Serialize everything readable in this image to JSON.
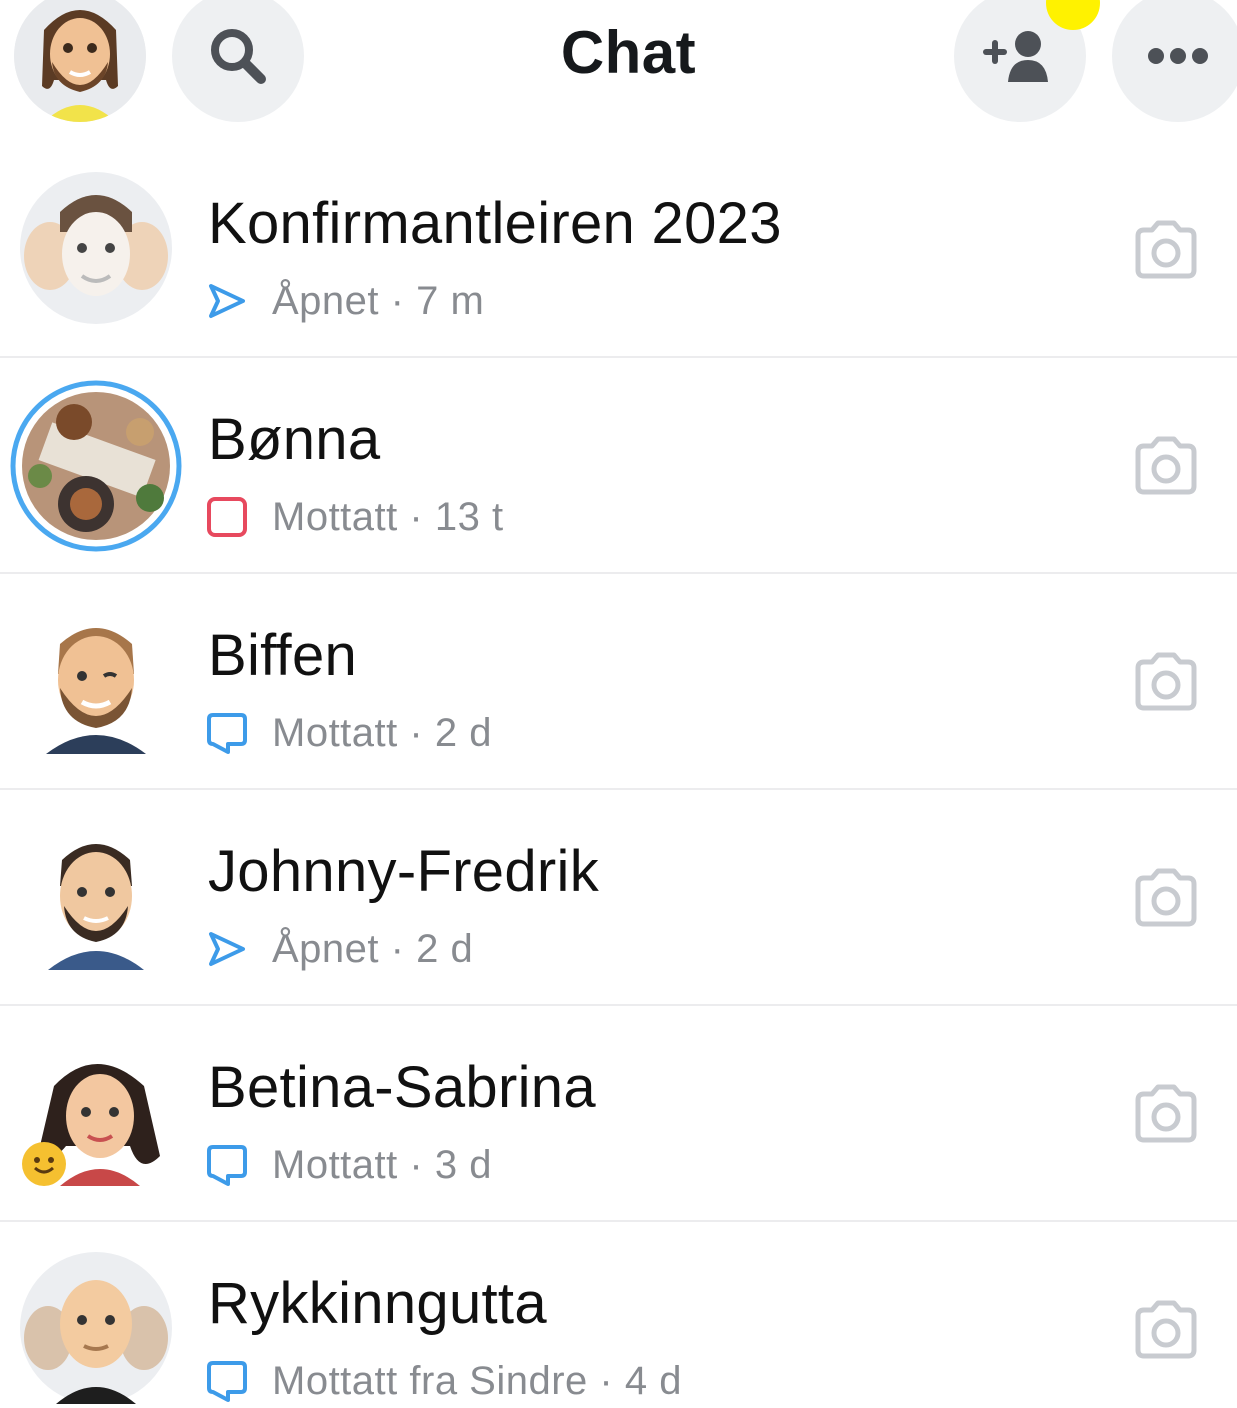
{
  "header": {
    "title": "Chat",
    "icons": {
      "profile": "profile-avatar",
      "search": "search-icon",
      "add_friend": "add-friend-icon",
      "more": "more-icon"
    },
    "colors": {
      "button_bg": "#eef0f2",
      "notification_dot": "#fff200"
    }
  },
  "chats": [
    {
      "name": "Konfirmantleiren 2023",
      "status": "Åpnet",
      "time": "7 m",
      "status_icon": "sent-opened-arrow-icon",
      "status_color": "#3d9be9"
    },
    {
      "name": "Bønna",
      "status": "Mottatt",
      "time": "13 t",
      "status_icon": "snap-received-square-icon",
      "status_color": "#e7495e"
    },
    {
      "name": "Biffen",
      "status": "Mottatt",
      "time": "2 d",
      "status_icon": "chat-received-bubble-icon",
      "status_color": "#3d9be9"
    },
    {
      "name": "Johnny-Fredrik",
      "status": "Åpnet",
      "time": "2 d",
      "status_icon": "sent-opened-arrow-icon",
      "status_color": "#3d9be9"
    },
    {
      "name": "Betina-Sabrina",
      "status": "Mottatt",
      "time": "3 d",
      "status_icon": "chat-received-bubble-icon",
      "status_color": "#3d9be9"
    },
    {
      "name": "Rykkinngutta",
      "status": "Mottatt fra Sindre",
      "time": "4 d",
      "status_icon": "chat-received-bubble-icon",
      "status_color": "#3d9be9"
    }
  ],
  "separator": "·",
  "row_action_icon": "camera-icon",
  "colors": {
    "text_primary": "#111111",
    "text_secondary": "#888b90",
    "story_ring": "#4aa8f0"
  }
}
